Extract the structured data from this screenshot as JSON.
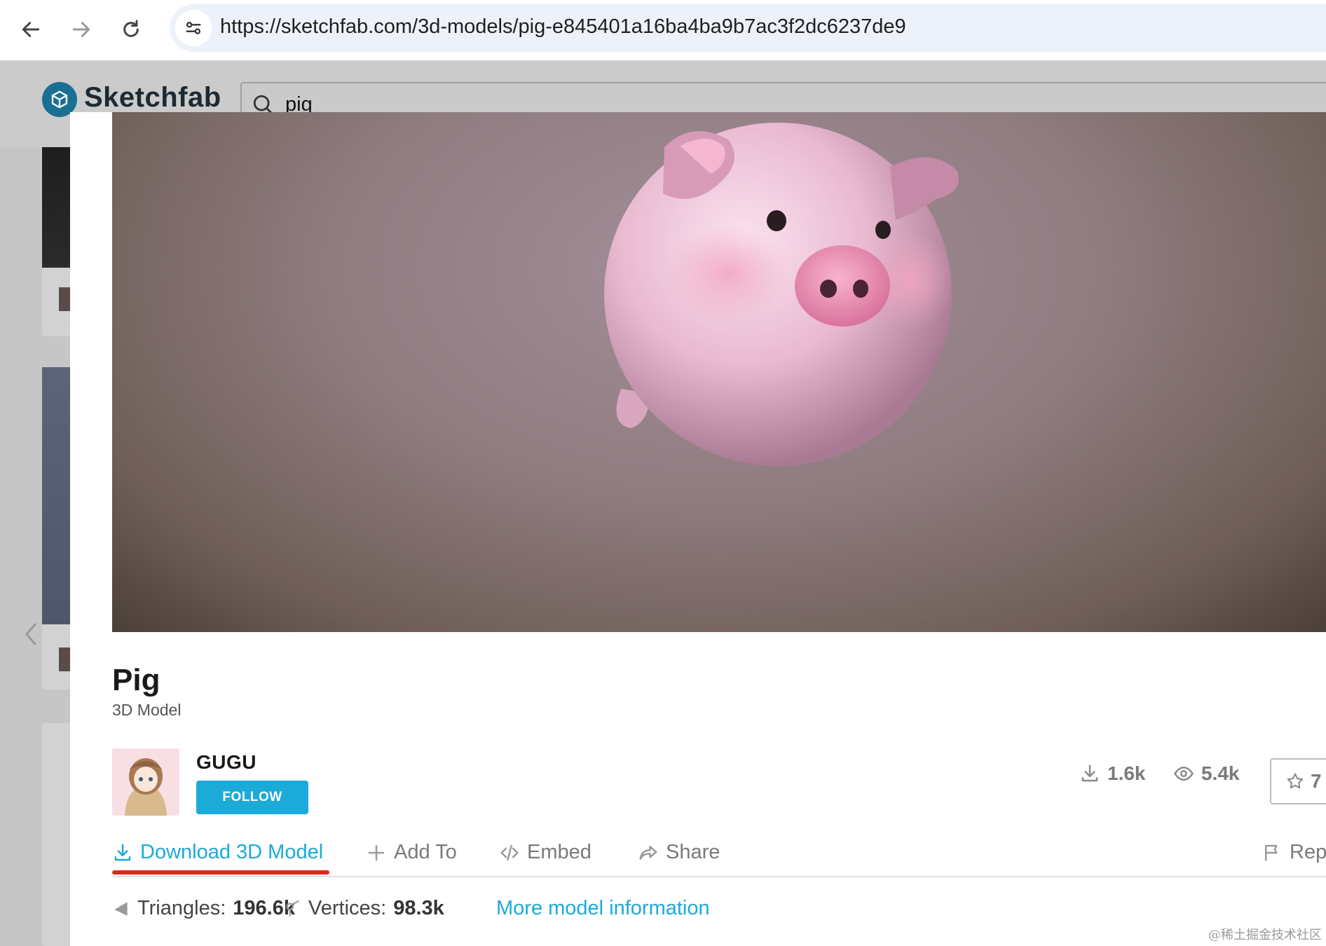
{
  "browser": {
    "url": "https://sketchfab.com/3d-models/pig-e845401a16ba4ba9b7ac3f2dc6237de9",
    "icons": {
      "back": "arrow-left-icon",
      "forward": "arrow-right-icon",
      "reload": "reload-icon",
      "site_settings": "tune-icon"
    }
  },
  "site": {
    "logo_text": "Sketchfab",
    "search_query": "pig"
  },
  "model": {
    "title": "Pig",
    "subtitle": "3D Model",
    "author": "GUGU",
    "follow_label": "FOLLOW",
    "downloads": "1.6k",
    "views": "5.4k",
    "likes": "7"
  },
  "actions": {
    "download": "Download 3D Model",
    "add_to": "Add To",
    "embed": "Embed",
    "share": "Share",
    "report": "Rep"
  },
  "stats": {
    "triangles_label": "Triangles:",
    "triangles_value": "196.6k",
    "vertices_label": "Vertices:",
    "vertices_value": "98.3k",
    "more_info": "More model information"
  },
  "watermark": "@稀土掘金技术社区",
  "colors": {
    "accent": "#1caad9",
    "highlight_underline": "#e1261c"
  }
}
